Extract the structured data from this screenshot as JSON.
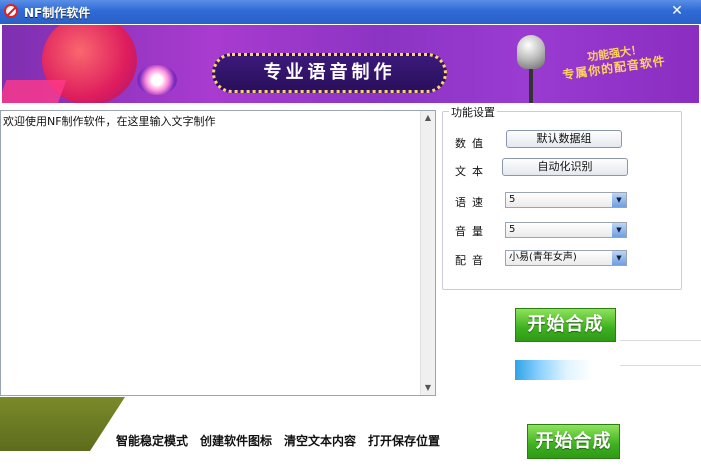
{
  "window": {
    "title": "NF制作软件",
    "close_glyph": "✕"
  },
  "banner": {
    "headline": "专业语音制作",
    "slogan_line1": "功能强大！",
    "slogan_line2": "专属你的配音软件"
  },
  "editor": {
    "text": "欢迎使用NF制作软件，在这里输入文字制作"
  },
  "settings": {
    "legend": "功能设置",
    "value_label": "数值",
    "value_button": "默认数据组",
    "text_label": "文本",
    "text_button": "自动化识别",
    "speed_label": "语速",
    "speed_value": "5",
    "volume_label": "音量",
    "volume_value": "5",
    "voice_label": "配音",
    "voice_value": "小易(青年女声)"
  },
  "actions": {
    "start_label": "开始合成",
    "start_label_bottom": "开始合成",
    "stable_mode": "智能稳定模式",
    "create_icon": "创建软件图标",
    "clear_text": "清空文本内容",
    "open_save": "打开保存位置"
  },
  "colors": {
    "titlebar": "#2f6ad6",
    "accent_green": "#3db020",
    "banner_purple": "#8b34c3"
  }
}
